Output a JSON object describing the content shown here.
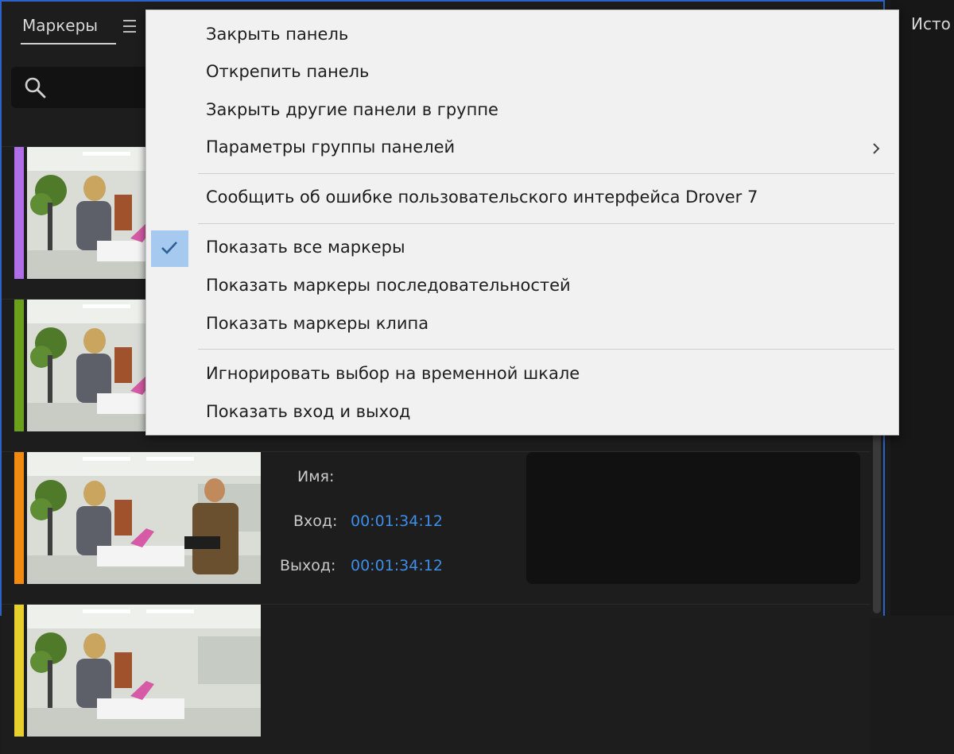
{
  "markers_panel": {
    "tab_label": "Маркеры",
    "search_placeholder": "",
    "accent_border": "#2d62c8",
    "markers": [
      {
        "color": "#b06fe8",
        "name_label": "",
        "in_label": "",
        "in_value": "",
        "out_label": "",
        "out_value": ""
      },
      {
        "color": "#6ba11a",
        "name_label": "",
        "in_label": "",
        "in_value": "",
        "out_label": "",
        "out_value": ""
      },
      {
        "color": "#f08a10",
        "name_label": "Имя:",
        "in_label": "Вход:",
        "in_value": "00:01:34:12",
        "out_label": "Выход:",
        "out_value": "00:01:34:12"
      },
      {
        "color": "#e7cf2c",
        "name_label": "",
        "in_label": "",
        "in_value": "",
        "out_label": "",
        "out_value": ""
      }
    ]
  },
  "right_panel": {
    "tab_label": "Исто"
  },
  "context_menu": {
    "items": [
      {
        "label": "Закрыть панель"
      },
      {
        "label": "Открепить панель"
      },
      {
        "label": "Закрыть другие панели в группе"
      },
      {
        "label": "Параметры группы панелей",
        "has_submenu": true
      },
      {
        "label": "Сообщить об ошибке пользовательского интерфейса Drover 7"
      },
      {
        "label": "Показать все маркеры",
        "checked": true
      },
      {
        "label": "Показать маркеры последовательностей"
      },
      {
        "label": "Показать маркеры клипа"
      },
      {
        "label": "Игнорировать выбор на временной шкале"
      },
      {
        "label": "Показать вход и выход"
      }
    ]
  },
  "icons": [
    "hamburger-menu-icon",
    "search-icon",
    "checkmark-icon",
    "chevron-right-icon"
  ]
}
